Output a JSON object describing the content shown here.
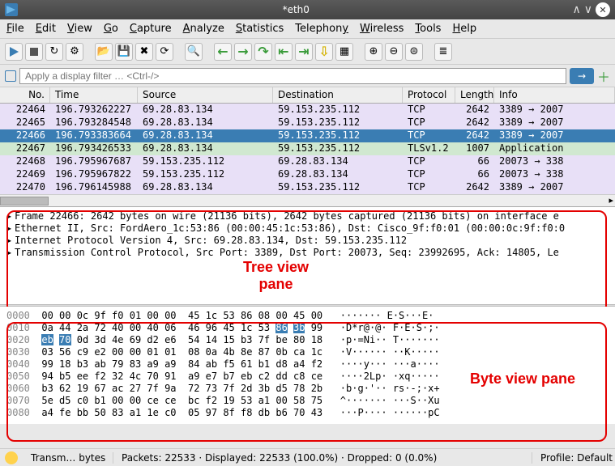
{
  "title": "*eth0",
  "menu": {
    "file": "File",
    "edit": "Edit",
    "view": "View",
    "go": "Go",
    "capture": "Capture",
    "analyze": "Analyze",
    "statistics": "Statistics",
    "telephony": "Telephony",
    "wireless": "Wireless",
    "tools": "Tools",
    "help": "Help"
  },
  "filter_placeholder": "Apply a display filter … <Ctrl-/>",
  "columns": {
    "no": "No.",
    "time": "Time",
    "source": "Source",
    "destination": "Destination",
    "protocol": "Protocol",
    "length": "Length",
    "info": "Info"
  },
  "packets": [
    {
      "no": "22464",
      "time": "196.793262227",
      "src": "69.28.83.134",
      "dst": "59.153.235.112",
      "pro": "TCP",
      "len": "2642",
      "info": "3389 → 2007",
      "cls": "e7e"
    },
    {
      "no": "22465",
      "time": "196.793284548",
      "src": "69.28.83.134",
      "dst": "59.153.235.112",
      "pro": "TCP",
      "len": "2642",
      "info": "3389 → 2007",
      "cls": "e7e"
    },
    {
      "no": "22466",
      "time": "196.793383664",
      "src": "69.28.83.134",
      "dst": "59.153.235.112",
      "pro": "TCP",
      "len": "2642",
      "info": "3389 → 2007",
      "cls": "sel"
    },
    {
      "no": "22467",
      "time": "196.793426533",
      "src": "69.28.83.134",
      "dst": "59.153.235.112",
      "pro": "TLSv1.2",
      "len": "1007",
      "info": "Application",
      "cls": "tls"
    },
    {
      "no": "22468",
      "time": "196.795967687",
      "src": "59.153.235.112",
      "dst": "69.28.83.134",
      "pro": "TCP",
      "len": "66",
      "info": "20073 → 338",
      "cls": "e7e"
    },
    {
      "no": "22469",
      "time": "196.795967822",
      "src": "59.153.235.112",
      "dst": "69.28.83.134",
      "pro": "TCP",
      "len": "66",
      "info": "20073 → 338",
      "cls": "e7e"
    },
    {
      "no": "22470",
      "time": "196.796145988",
      "src": "69.28.83.134",
      "dst": "59.153.235.112",
      "pro": "TCP",
      "len": "2642",
      "info": "3389 → 2007",
      "cls": "e7e"
    }
  ],
  "tree": [
    "Frame 22466: 2642 bytes on wire (21136 bits), 2642 bytes captured (21136 bits) on interface e",
    "Ethernet II, Src: FordAero_1c:53:86 (00:00:45:1c:53:86), Dst: Cisco_9f:f0:01 (00:00:0c:9f:f0:0",
    "Internet Protocol Version 4, Src: 69.28.83.134, Dst: 59.153.235.112",
    "Transmission Control Protocol, Src Port: 3389, Dst Port: 20073, Seq: 23992695, Ack: 14805, Le"
  ],
  "annot": {
    "tree": "Tree view\npane",
    "hex": "Byte view pane"
  },
  "hex": {
    "rows": [
      {
        "off": "0000",
        "b": "00 00 0c 9f f0 01 00 00  45 1c 53 86 08 00 45 00",
        "a": "······· E·S···E·",
        "hl": []
      },
      {
        "off": "0010",
        "b": "0a 44 2a 72 40 00 40 06  46 96 45 1c 53 86 3b 99",
        "a": "·D*r@·@· F·E·S·;·",
        "hl": [
          14,
          15
        ]
      },
      {
        "off": "0020",
        "b": "eb 70 0d 3d 4e 69 d2 e6  54 14 15 b3 7f be 80 18",
        "a": "·p·=Ni·· T·······",
        "hl": [
          0,
          1
        ]
      },
      {
        "off": "0030",
        "b": "03 56 c9 e2 00 00 01 01  08 0a 4b 8e 87 0b ca 1c",
        "a": "·V······ ··K·····",
        "hl": []
      },
      {
        "off": "0040",
        "b": "99 18 b3 ab 79 83 a9 a9  84 ab f5 61 b1 d8 a4 f2",
        "a": "····y··· ···a····",
        "hl": []
      },
      {
        "off": "0050",
        "b": "94 b5 ee f2 32 4c 70 91  a9 e7 b7 eb c2 dd c8 ce",
        "a": "····2Lp· ·xq·····",
        "hl": []
      },
      {
        "off": "0060",
        "b": "b3 62 19 67 ac 27 7f 9a  72 73 7f 2d 3b d5 78 2b",
        "a": "·b·g·'·· rs·-;·x+",
        "hl": []
      },
      {
        "off": "0070",
        "b": "5e d5 c0 b1 00 00 ce ce  bc f2 19 53 a1 00 58 75",
        "a": "^······· ···S··Xu",
        "hl": []
      },
      {
        "off": "0080",
        "b": "a4 fe bb 50 83 a1 1e c0  05 97 8f f8 db b6 70 43",
        "a": "···P···· ······pC",
        "hl": []
      }
    ]
  },
  "status": {
    "s1": "Transm… bytes",
    "s2": "Packets: 22533 · Displayed: 22533 (100.0%) · Dropped: 0 (0.0%)",
    "s3": "Profile: Default"
  }
}
